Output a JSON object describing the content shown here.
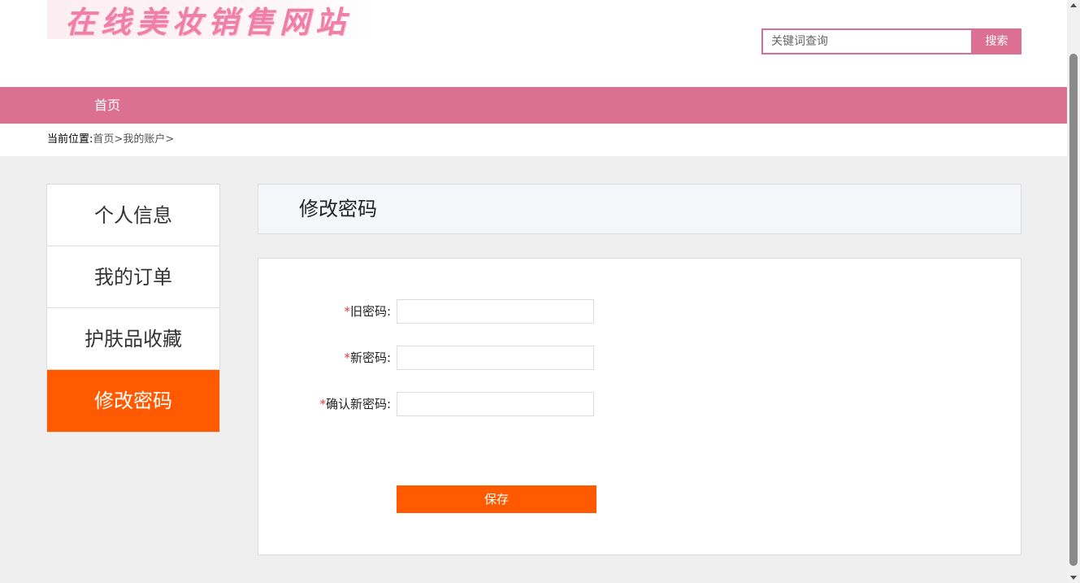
{
  "header": {
    "logo_text": "在线美妆销售网站",
    "search_placeholder": "关键词查询",
    "search_button": "搜索"
  },
  "nav": {
    "items": [
      {
        "label": "首页"
      }
    ]
  },
  "breadcrumb": {
    "label": "当前位置:",
    "items": [
      "首页",
      ">",
      "我的账户",
      ">"
    ]
  },
  "sidebar": {
    "items": [
      {
        "label": "个人信息"
      },
      {
        "label": "我的订单"
      },
      {
        "label": "护肤品收藏"
      },
      {
        "label": "修改密码",
        "active": true
      }
    ]
  },
  "main": {
    "title": "修改密码",
    "form": {
      "required_mark": "*",
      "fields": [
        {
          "label": "旧密码:",
          "value": ""
        },
        {
          "label": "新密码:",
          "value": ""
        },
        {
          "label": "确认新密码:",
          "value": ""
        }
      ],
      "save_button": "保存"
    }
  },
  "colors": {
    "brand_pink": "#dc7092",
    "accent_orange": "#ff5a00",
    "required_red": "#e23b3b"
  }
}
